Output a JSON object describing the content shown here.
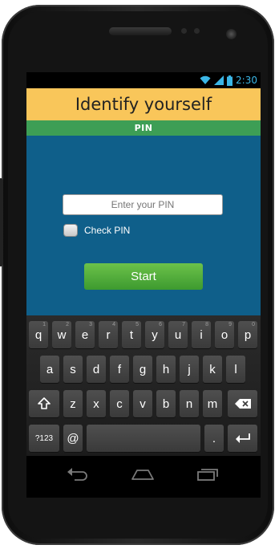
{
  "status": {
    "time": "2:30",
    "icons": [
      "wifi-icon",
      "signal-icon",
      "battery-icon"
    ]
  },
  "app": {
    "title": "Identify yourself",
    "section": "PIN"
  },
  "form": {
    "pin_placeholder": "Enter your PIN",
    "check_label": "Check PIN",
    "check_checked": false,
    "start_label": "Start"
  },
  "keyboard": {
    "row1": [
      {
        "k": "q",
        "h": "1"
      },
      {
        "k": "w",
        "h": "2"
      },
      {
        "k": "e",
        "h": "3"
      },
      {
        "k": "r",
        "h": "4"
      },
      {
        "k": "t",
        "h": "5"
      },
      {
        "k": "y",
        "h": "6"
      },
      {
        "k": "u",
        "h": "7"
      },
      {
        "k": "i",
        "h": "8"
      },
      {
        "k": "o",
        "h": "9"
      },
      {
        "k": "p",
        "h": "0"
      }
    ],
    "row2": [
      "a",
      "s",
      "d",
      "f",
      "g",
      "h",
      "j",
      "k",
      "l"
    ],
    "row3": [
      "z",
      "x",
      "c",
      "v",
      "b",
      "n",
      "m"
    ],
    "symbols": "?123",
    "at": "@",
    "period": "."
  },
  "colors": {
    "title_bar": "#f9c65a",
    "section_bar": "#3d9e55",
    "content_bg": "#0f5f8a",
    "button": "#5cb83c",
    "status_icons": "#3bb6e6"
  }
}
